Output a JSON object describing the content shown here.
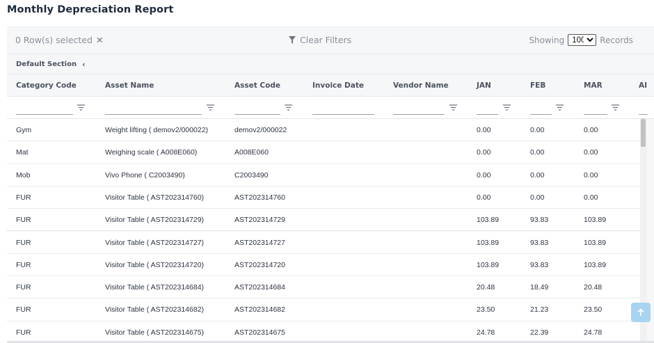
{
  "page": {
    "title": "Monthly Depreciation Report"
  },
  "toolbar": {
    "selected_text": "0 Row(s) selected",
    "clear_selection_icon": "close-icon",
    "clear_filters_label": "Clear Filters",
    "showing_label": "Showing",
    "page_size": "100",
    "page_size_options": [
      "100"
    ],
    "records_label": "Records"
  },
  "section": {
    "label": "Default Section",
    "toggle_icon": "chevron-left-icon"
  },
  "table": {
    "columns": [
      {
        "key": "category",
        "label": "Category Code"
      },
      {
        "key": "asset_name",
        "label": "Asset Name"
      },
      {
        "key": "asset_code",
        "label": "Asset Code"
      },
      {
        "key": "invoice_date",
        "label": "Invoice Date"
      },
      {
        "key": "vendor_name",
        "label": "Vendor Name"
      },
      {
        "key": "jan",
        "label": "JAN"
      },
      {
        "key": "feb",
        "label": "FEB"
      },
      {
        "key": "mar",
        "label": "MAR"
      },
      {
        "key": "apr",
        "label": "AI"
      }
    ],
    "rows": [
      {
        "category": "Gym",
        "asset_name": "Weight lifting ( demov2/000022)",
        "asset_code": "demov2/000022",
        "invoice_date": "",
        "vendor_name": "",
        "jan": "0.00",
        "feb": "0.00",
        "mar": "0.00"
      },
      {
        "category": "Mat",
        "asset_name": "Weighing scale ( A008E060)",
        "asset_code": "A008E060",
        "invoice_date": "",
        "vendor_name": "",
        "jan": "0.00",
        "feb": "0.00",
        "mar": "0.00"
      },
      {
        "category": "Mob",
        "asset_name": "Vivo Phone ( C2003490)",
        "asset_code": "C2003490",
        "invoice_date": "",
        "vendor_name": "",
        "jan": "0.00",
        "feb": "0.00",
        "mar": "0.00"
      },
      {
        "category": "FUR",
        "asset_name": "Visitor Table ( AST202314760)",
        "asset_code": "AST202314760",
        "invoice_date": "",
        "vendor_name": "",
        "jan": "0.00",
        "feb": "0.00",
        "mar": "0.00"
      },
      {
        "category": "FUR",
        "asset_name": "Visitor Table ( AST202314729)",
        "asset_code": "AST202314729",
        "invoice_date": "",
        "vendor_name": "",
        "jan": "103.89",
        "feb": "93.83",
        "mar": "103.89"
      },
      {
        "category": "FUR",
        "asset_name": "Visitor Table ( AST202314727)",
        "asset_code": "AST202314727",
        "invoice_date": "",
        "vendor_name": "",
        "jan": "103.89",
        "feb": "93.83",
        "mar": "103.89"
      },
      {
        "category": "FUR",
        "asset_name": "Visitor Table ( AST202314720)",
        "asset_code": "AST202314720",
        "invoice_date": "",
        "vendor_name": "",
        "jan": "103.89",
        "feb": "93.83",
        "mar": "103.89"
      },
      {
        "category": "FUR",
        "asset_name": "Visitor Table ( AST202314684)",
        "asset_code": "AST202314684",
        "invoice_date": "",
        "vendor_name": "",
        "jan": "20.48",
        "feb": "18.49",
        "mar": "20.48"
      },
      {
        "category": "FUR",
        "asset_name": "Visitor Table ( AST202314682)",
        "asset_code": "AST202314682",
        "invoice_date": "",
        "vendor_name": "",
        "jan": "23.50",
        "feb": "21.23",
        "mar": "23.50"
      },
      {
        "category": "FUR",
        "asset_name": "Visitor Table ( AST202314675)",
        "asset_code": "AST202314675",
        "invoice_date": "",
        "vendor_name": "",
        "jan": "24.78",
        "feb": "22.39",
        "mar": "24.78"
      }
    ]
  },
  "icons": {
    "filter": "filter-icon",
    "scroll_top": "arrow-up-icon"
  },
  "colors": {
    "title": "#1e2a3b",
    "muted_text": "#8a9099",
    "header_text": "#4b5360",
    "panel_bg": "#f6f7f9",
    "scroll_top_bg": "#a8d3f1"
  }
}
